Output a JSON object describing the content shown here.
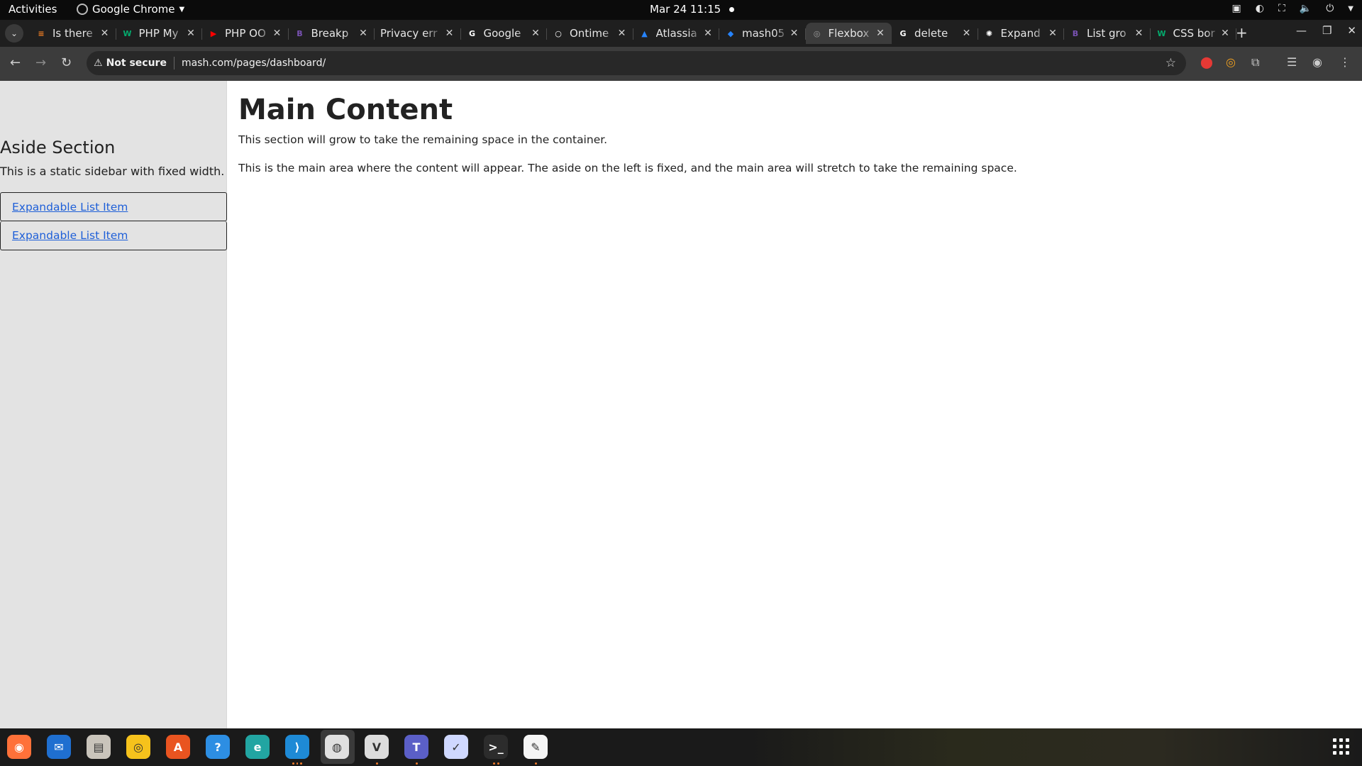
{
  "topbar": {
    "activities": "Activities",
    "app_name": "Google Chrome",
    "clock": "Mar 24  11:15",
    "tray_icons": [
      "teams-icon",
      "night-light-icon",
      "network-icon",
      "volume-icon",
      "power-icon"
    ]
  },
  "tabs": [
    {
      "title": "Is there",
      "icon": "stackoverflow-icon",
      "color": "#f48024",
      "glyph": "≡"
    },
    {
      "title": "PHP My",
      "icon": "w3schools-icon",
      "color": "#04aa6d",
      "glyph": "W"
    },
    {
      "title": "PHP OO",
      "icon": "youtube-icon",
      "color": "#ff0000",
      "glyph": "▶"
    },
    {
      "title": "Breakp",
      "icon": "bootstrap-icon",
      "color": "#7952b3",
      "glyph": "B"
    },
    {
      "title": "Privacy err",
      "icon": "none",
      "color": "",
      "glyph": ""
    },
    {
      "title": "Google",
      "icon": "google-icon",
      "color": "#ffffff",
      "glyph": "G"
    },
    {
      "title": "Ontime",
      "icon": "ontime-icon",
      "color": "#ffffff",
      "glyph": "○"
    },
    {
      "title": "Atlassia",
      "icon": "atlassian-icon",
      "color": "#2684ff",
      "glyph": "▲"
    },
    {
      "title": "mash05",
      "icon": "bitbucket-icon",
      "color": "#2684ff",
      "glyph": "◆"
    },
    {
      "title": "Flexbox",
      "icon": "globe-icon",
      "color": "#9e9e9e",
      "glyph": "◎",
      "active": true
    },
    {
      "title": "delete",
      "icon": "google-icon",
      "color": "#ffffff",
      "glyph": "G"
    },
    {
      "title": "Expand",
      "icon": "openai-icon",
      "color": "#ffffff",
      "glyph": "✺"
    },
    {
      "title": "List gro",
      "icon": "bootstrap-icon",
      "color": "#7952b3",
      "glyph": "B"
    },
    {
      "title": "CSS bor",
      "icon": "w3schools-icon",
      "color": "#04aa6d",
      "glyph": "W"
    }
  ],
  "toolbar": {
    "security_label": "Not secure",
    "url": "mash.com/pages/dashboard/"
  },
  "page": {
    "aside": {
      "heading": "Aside Section",
      "description": "This is a static sidebar with fixed width.",
      "items": [
        "Expandable List Item",
        "Expandable List Item"
      ]
    },
    "main": {
      "heading": "Main Content",
      "paragraph1": "This section will grow to take the remaining space in the container.",
      "paragraph2": "This is the main area where the content will appear. The aside on the left is fixed, and the main area will stretch to take the remaining space."
    }
  },
  "dock": [
    {
      "name": "firefox-icon",
      "color": "#ff7139"
    },
    {
      "name": "thunderbird-icon",
      "color": "#1f6fd0"
    },
    {
      "name": "files-icon",
      "color": "#c9c4bb"
    },
    {
      "name": "rhythmbox-icon",
      "color": "#f6c21c"
    },
    {
      "name": "software-center-icon",
      "color": "#e95420"
    },
    {
      "name": "help-icon",
      "color": "#2d8ee3"
    },
    {
      "name": "edge-icon",
      "color": "#22a5a2"
    },
    {
      "name": "vscode-icon",
      "color": "#1e8ad6"
    },
    {
      "name": "chrome-icon",
      "color": "#e0e0e0"
    },
    {
      "name": "vim-icon",
      "color": "#dcdcdc"
    },
    {
      "name": "teams-icon",
      "color": "#5b5fc7"
    },
    {
      "name": "messenger-icon",
      "color": "#cfd8ff"
    },
    {
      "name": "terminal-icon",
      "color": "#2c2c2c"
    },
    {
      "name": "text-editor-icon",
      "color": "#f5f5f5"
    }
  ]
}
